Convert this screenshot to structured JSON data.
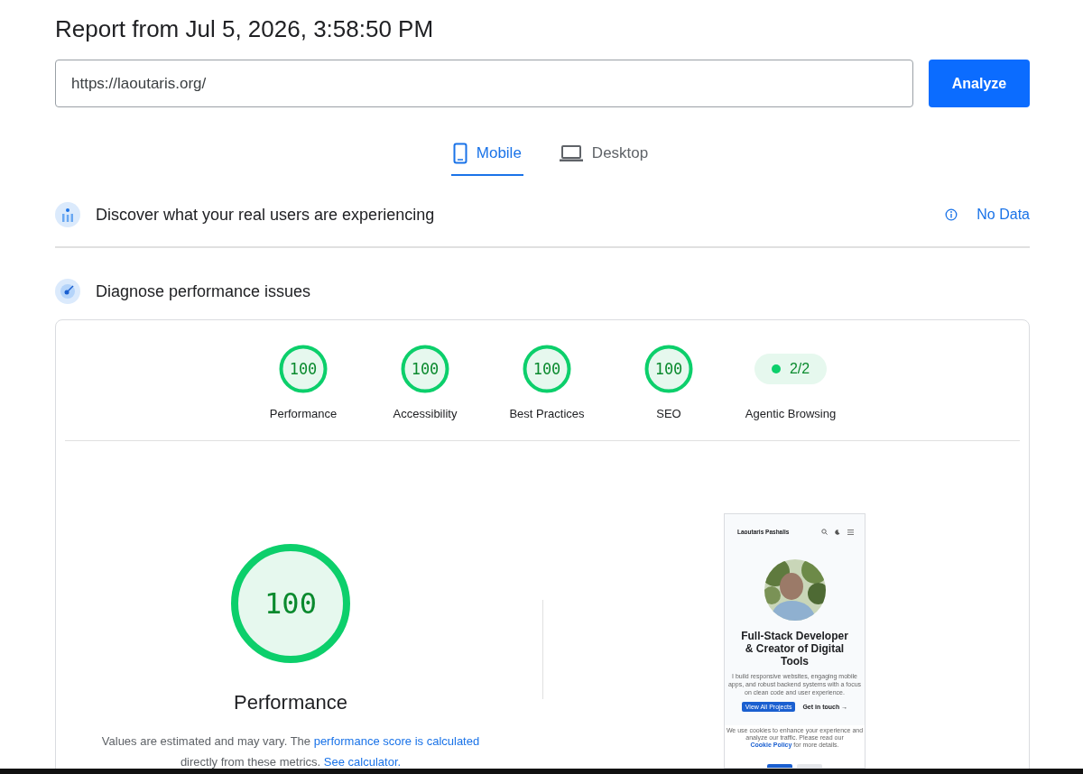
{
  "report_title": "Report from Jul 5, 2026, 3:58:50 PM",
  "url_field": {
    "value": "https://laoutaris.org/"
  },
  "analyze_button": "Analyze",
  "device_tabs": [
    {
      "label": "Mobile",
      "kind": "mobile",
      "selected": true
    },
    {
      "label": "Desktop",
      "kind": "desktop",
      "selected": false
    }
  ],
  "field_data": {
    "heading": "Discover what your real users are experiencing",
    "status": "No Data"
  },
  "lab_data": {
    "heading": "Diagnose performance issues",
    "scores": [
      {
        "kind": "gauge",
        "value": "100",
        "level": 1,
        "label": "Performance"
      },
      {
        "kind": "gauge",
        "value": "100",
        "level": 1,
        "label": "Accessibility"
      },
      {
        "kind": "gauge",
        "value": "100",
        "level": 1,
        "label": "Best Practices"
      },
      {
        "kind": "gauge",
        "value": "100",
        "level": 1,
        "label": "SEO"
      },
      {
        "kind": "fraction",
        "value": "2/2",
        "label": "Agentic Browsing"
      }
    ],
    "main_score": {
      "value": "100",
      "level": 1,
      "label": "Performance",
      "note": [
        "Values are estimated and may vary. The ",
        "performance score is calculated",
        " directly from these metrics. ",
        "See calculator."
      ]
    },
    "preview": {
      "site_name": "Laoutaris Pashalis",
      "headline": "Full-Stack Developer & Creator of Digital Tools",
      "intro": "I build responsive websites, engaging mobile apps, and robust backend systems with a focus on clean code and user experience.",
      "primary_button": "View All Projects",
      "secondary_link": "Get in touch →",
      "cookie_notice": "We use cookies to enhance your experience and analyze our traffic. Please read our ",
      "cookie_link": "Cookie Policy",
      "cookie_tail": " for more details."
    }
  }
}
